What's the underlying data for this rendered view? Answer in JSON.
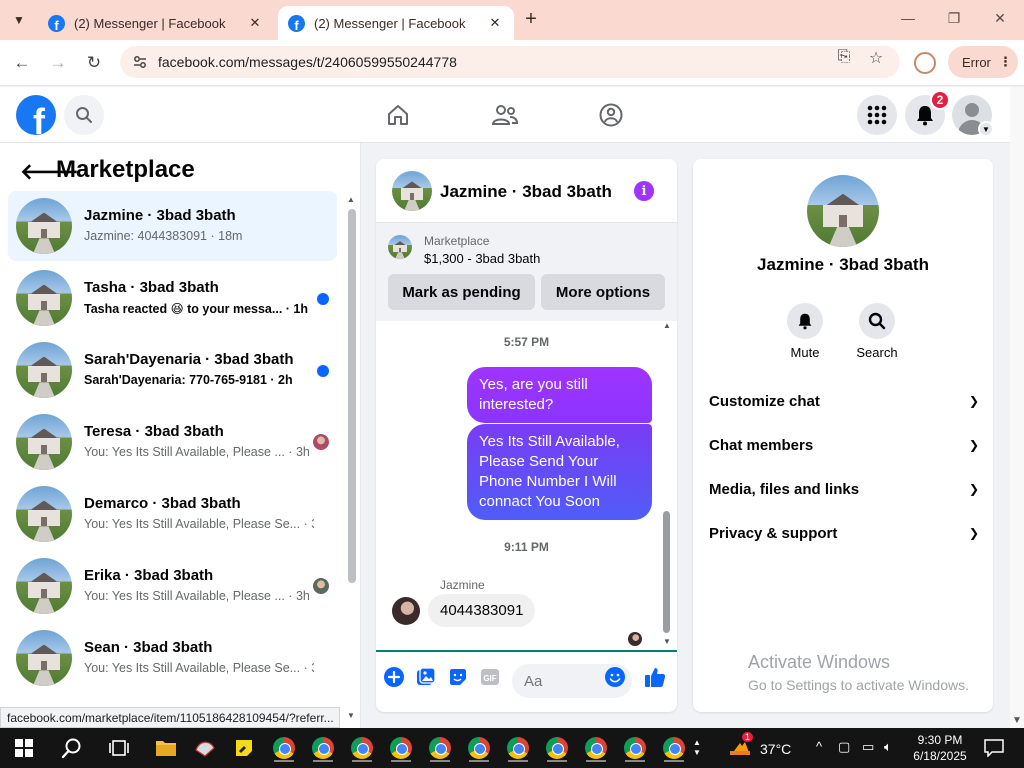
{
  "browser": {
    "tabs": [
      {
        "title": "(2) Messenger | Facebook",
        "active": false
      },
      {
        "title": "(2) Messenger | Facebook",
        "active": true
      }
    ],
    "url": "facebook.com/messages/t/24060599550244778",
    "error_label": "Error",
    "status_url": "facebook.com/marketplace/item/1105186428109454/?referr..."
  },
  "fb_header": {
    "notification_count": "2",
    "brand_color": "#1877f2"
  },
  "sidebar": {
    "title": "Marketplace",
    "conversations": [
      {
        "name": "Jazmine · 3bad 3bath",
        "preview": "Jazmine: 4044383091 · 18m",
        "active": true,
        "unread": false,
        "indicator": "none"
      },
      {
        "name": "Tasha · 3bad 3bath",
        "preview": "Tasha reacted 😆 to your messa... · 1h",
        "active": false,
        "unread": true,
        "indicator": "dot"
      },
      {
        "name": "Sarah'Dayenaria · 3bad 3bath",
        "preview": "Sarah'Dayenaria: 770-765-9181 · 2h",
        "active": false,
        "unread": true,
        "indicator": "dot"
      },
      {
        "name": "Teresa · 3bad 3bath",
        "preview": "You: Yes Its Still Available, Please ... · 3h",
        "active": false,
        "unread": false,
        "indicator": "avatar"
      },
      {
        "name": "Demarco · 3bad 3bath",
        "preview": "You: Yes Its Still Available, Please Se... · 3h",
        "active": false,
        "unread": false,
        "indicator": "none"
      },
      {
        "name": "Erika · 3bad 3bath",
        "preview": "You: Yes Its Still Available, Please ... · 3h",
        "active": false,
        "unread": false,
        "indicator": "avatar"
      },
      {
        "name": "Sean · 3bad 3bath",
        "preview": "You: Yes Its Still Available, Please Se... · 3h",
        "active": false,
        "unread": false,
        "indicator": "none"
      }
    ]
  },
  "chat": {
    "title": "Jazmine · 3bad 3bath",
    "marketplace_label": "Marketplace",
    "listing": "$1,300 - 3bad 3bath",
    "mark_pending_label": "Mark as pending",
    "more_options_label": "More options",
    "time1": "5:57 PM",
    "msg_out_1": "Yes, are you still interested?",
    "msg_out_2": "Yes Its Still Available, Please Send Your Phone Number I Will connact You Soon",
    "time2": "9:11 PM",
    "sender": "Jazmine",
    "msg_in_1": "4044383091",
    "composer_placeholder": "Aa",
    "accent_color": "#a033ff"
  },
  "info": {
    "title": "Jazmine · 3bad 3bath",
    "mute_label": "Mute",
    "search_label": "Search",
    "sections": [
      "Customize chat",
      "Chat members",
      "Media, files and links",
      "Privacy & support"
    ],
    "watermark_line1": "Activate Windows",
    "watermark_line2": "Go to Settings to activate Windows."
  },
  "taskbar": {
    "weather": "37°C",
    "weather_badge": "1",
    "time": "9:30 PM",
    "date": "6/18/2025"
  }
}
